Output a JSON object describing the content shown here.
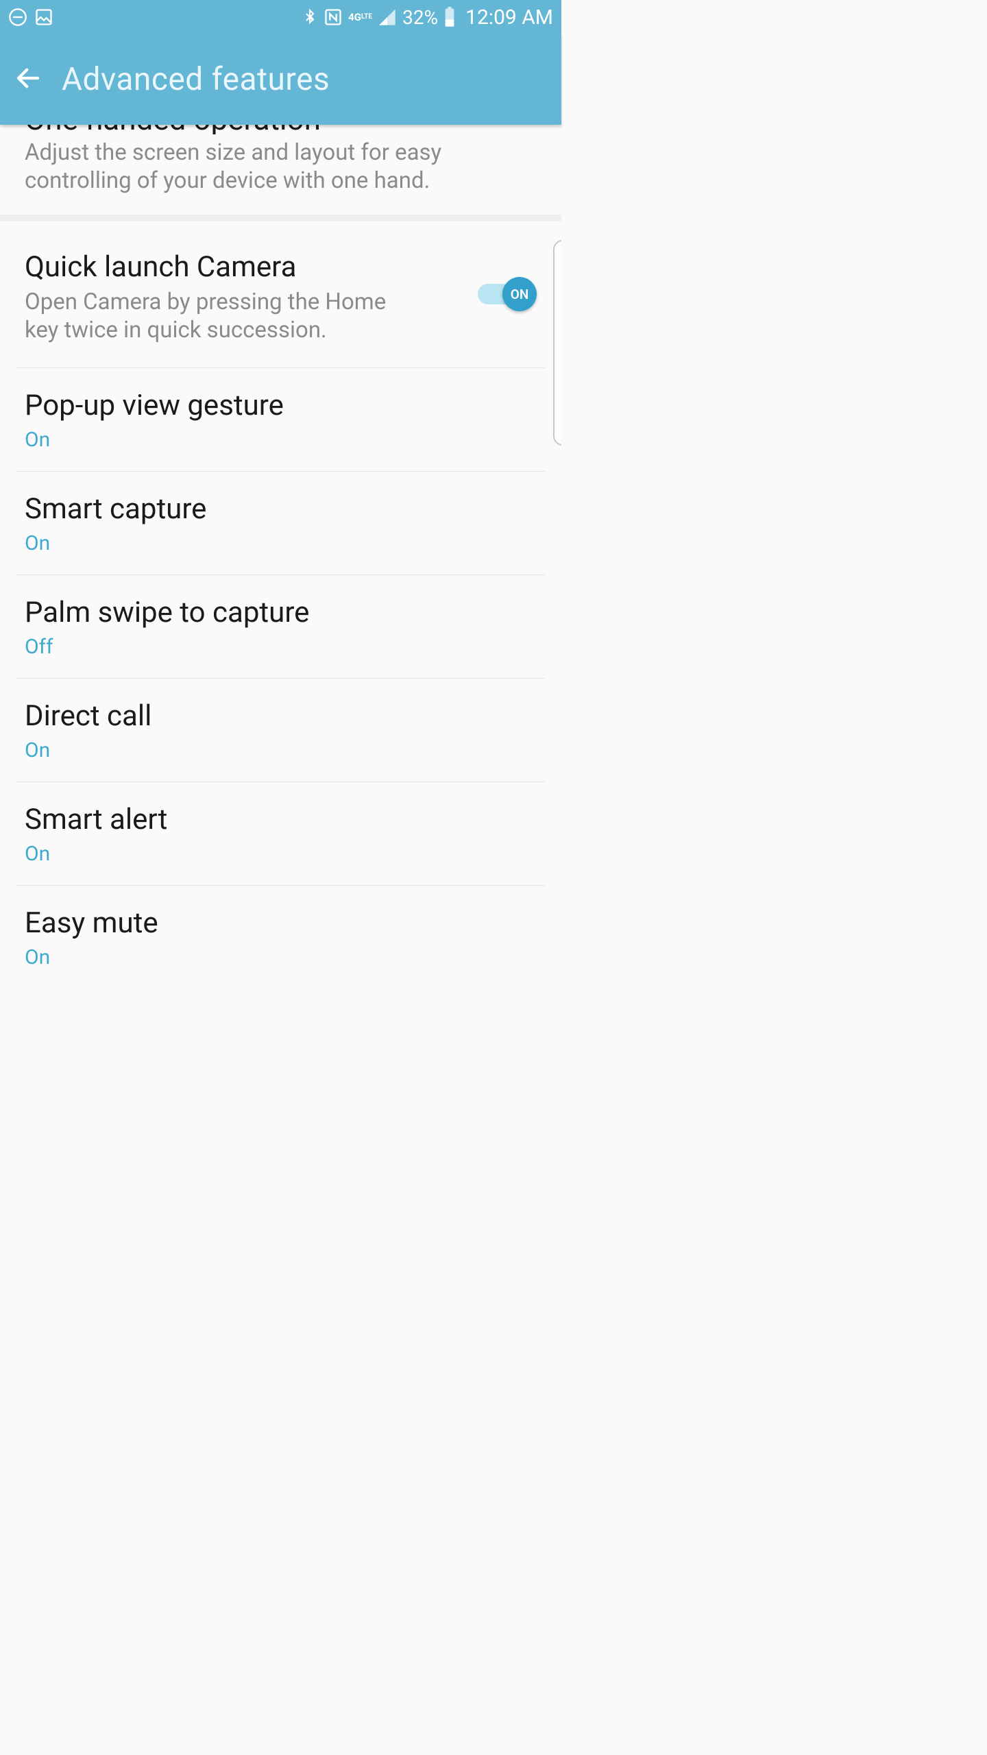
{
  "status": {
    "battery_pct": "32%",
    "time": "12:09 AM",
    "network": "4G LTE"
  },
  "appbar": {
    "title": "Advanced features"
  },
  "cut_item": {
    "title": "One-handed operation",
    "desc": "Adjust the screen size and layout for easy controlling of your device with one hand."
  },
  "items": {
    "quick_camera": {
      "title": "Quick launch Camera",
      "desc": "Open Camera by pressing the Home key twice in quick succession.",
      "toggle_label": "ON"
    },
    "popup": {
      "title": "Pop-up view gesture",
      "state": "On"
    },
    "smart_capture": {
      "title": "Smart capture",
      "state": "On"
    },
    "palm": {
      "title": "Palm swipe to capture",
      "state": "Off"
    },
    "direct_call": {
      "title": "Direct call",
      "state": "On"
    },
    "smart_alert": {
      "title": "Smart alert",
      "state": "On"
    },
    "easy_mute": {
      "title": "Easy mute",
      "state": "On"
    }
  }
}
